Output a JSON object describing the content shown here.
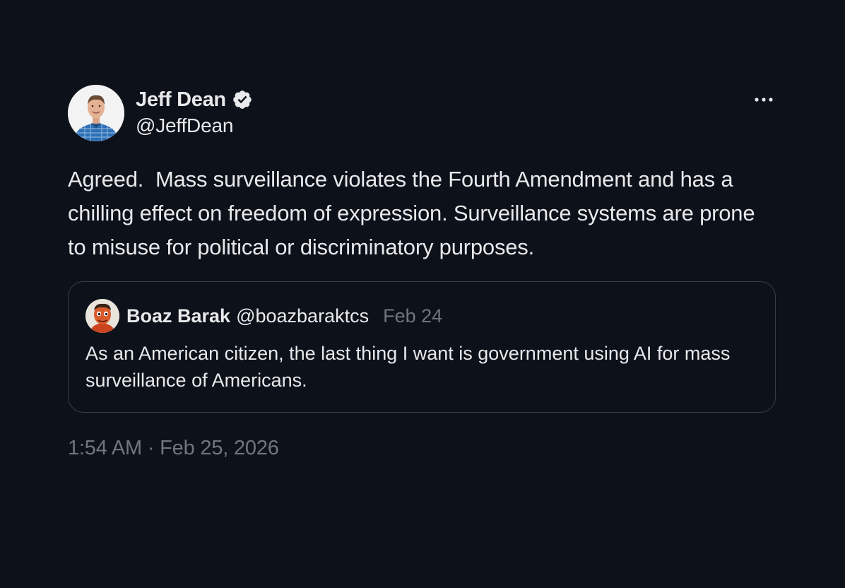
{
  "tweet": {
    "author": {
      "display_name": "Jeff Dean",
      "handle": "@JeffDean",
      "verified": true,
      "avatar_icon": "avatar-photo"
    },
    "text": "Agreed.  Mass surveillance violates the Fourth Amendment and has a chilling effect on freedom of expression. Surveillance systems are prone to misuse for political or discriminatory purposes.",
    "timestamp": "1:54 AM · Feb 25, 2026",
    "more_icon": "more-horizontal-icon"
  },
  "quote": {
    "display_name": "Boaz Barak",
    "handle": "@boazbaraktcs",
    "date": "Feb 24",
    "text": "As an American citizen, the last thing I want is government using AI for mass surveillance of Americans."
  },
  "colors": {
    "background": "#0d111a",
    "text": "#e7e9ea",
    "secondary_text": "#71767b",
    "border": "#3a3f45",
    "verified_badge": "#e7e9ea"
  }
}
